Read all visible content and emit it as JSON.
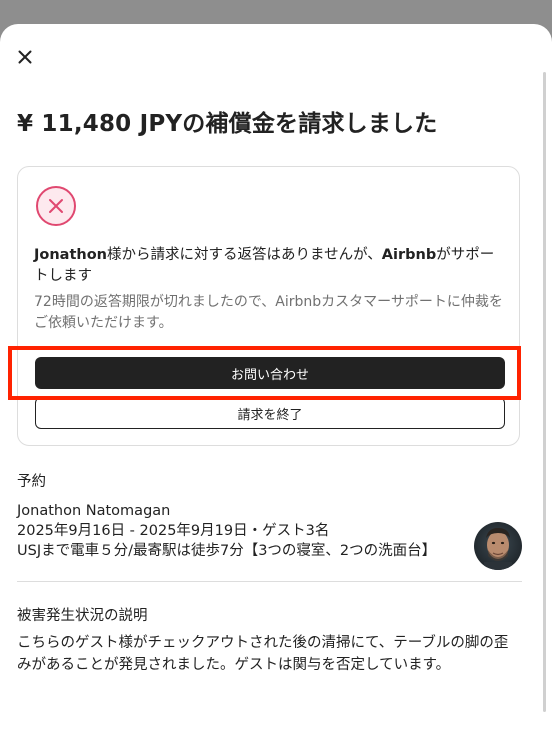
{
  "modal": {
    "close_icon": "close-icon",
    "title": "¥ 11,480 JPYの補償金を請求しました"
  },
  "status_card": {
    "icon": "x-circle-icon",
    "icon_color": "#e04870",
    "heading_prefix": "Jonathon",
    "heading_mid": "様から請求に対する返答はありませんが、",
    "heading_brand": "Airbnb",
    "heading_suffix": "がサポートします",
    "subtext": "72時間の返答期限が切れましたので、Airbnbカスタマーサポートに仲裁をご依頼いただけます。",
    "contact_button_label": "お問い合わせ",
    "end_claim_button_label": "請求を終了"
  },
  "reservation": {
    "section_label": "予約",
    "guest_name": "Jonathon Natomagan",
    "dates_and_guests": "2025年9月16日 - 2025年9月19日・ゲスト3名",
    "listing_title": "USJまで電車５分/最寄駅は徒歩7分【3つの寝室、2つの洗面台】"
  },
  "damage": {
    "section_label": "被害発生状況の説明",
    "description": "こちらのゲスト様がチェックアウトされた後の清掃にて、テーブルの脚の歪みがあることが発見されました。ゲストは関与を否定しています。"
  },
  "colors": {
    "primary_button": "#222222",
    "highlight_annotation": "#ff2200"
  }
}
